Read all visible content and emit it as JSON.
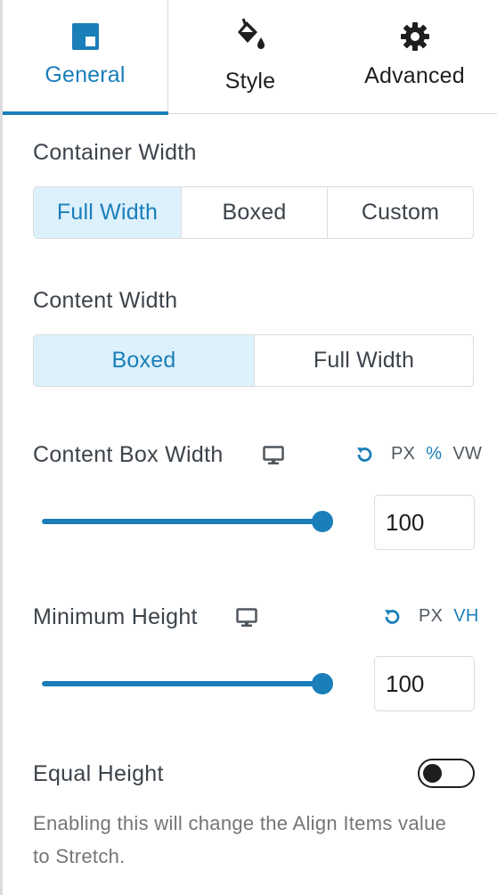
{
  "tabs": {
    "general": {
      "label": "General",
      "icon": "layout-block-icon"
    },
    "style": {
      "label": "Style",
      "icon": "paint-bucket-icon"
    },
    "advanced": {
      "label": "Advanced",
      "icon": "gear-icon"
    }
  },
  "colors": {
    "accent": "#1a7eb9",
    "active_bg": "#dcf1fc",
    "border": "#dcdcde"
  },
  "container_width": {
    "label": "Container Width",
    "options": [
      "Full Width",
      "Boxed",
      "Custom"
    ],
    "selected": "Full Width"
  },
  "content_width": {
    "label": "Content Width",
    "options": [
      "Boxed",
      "Full Width"
    ],
    "selected": "Boxed"
  },
  "content_box_width": {
    "label": "Content Box Width",
    "units": [
      "PX",
      "%",
      "VW"
    ],
    "selected_unit": "%",
    "value": "100",
    "slider_fraction": 1.0
  },
  "minimum_height": {
    "label": "Minimum Height",
    "units": [
      "PX",
      "VH"
    ],
    "selected_unit": "VH",
    "value": "100",
    "slider_fraction": 1.0
  },
  "equal_height": {
    "label": "Equal Height",
    "enabled": false,
    "help": "Enabling this will change the Align Items value to Stretch."
  }
}
